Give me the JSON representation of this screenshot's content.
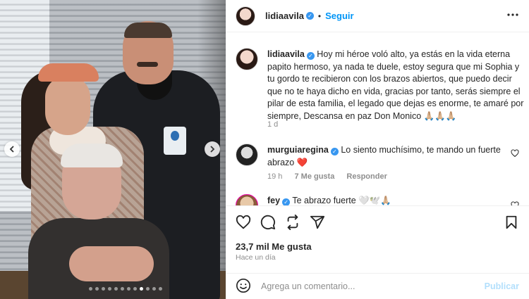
{
  "post": {
    "author": "lidiaavila",
    "follow_label": "Seguir",
    "separator": "•",
    "more_icon": "more-horizontal-icon"
  },
  "caption": {
    "author": "lidiaavila",
    "text": "Hoy mi héroe voló alto, ya estás en la vida eterna papito hermoso, ya nada te duele, estoy segura que mi Sophia y tu gordo te recibieron con los brazos abiertos, que puedo decir que no te haya dicho en vida, gracias por tanto, serás siempre el pilar de esta familia, el legado que dejas es enorme, te amaré por siempre, Descansa en paz Don Monico 🙏🏼🙏🏼🙏🏼",
    "age": "1 d"
  },
  "comments": [
    {
      "author": "murguiaregina",
      "text": "Lo siento muchísimo, te mando un fuerte abrazo ❤️",
      "age": "19 h",
      "likes": "7 Me gusta",
      "reply": "Responder"
    },
    {
      "author": "fey",
      "text": "Te abrazo fuerte 🤍🕊️🙏🏼"
    }
  ],
  "actions": {
    "like_icon": "heart-icon",
    "comment_icon": "comment-icon",
    "share_icon": "repost-icon",
    "send_icon": "send-icon",
    "save_icon": "bookmark-icon"
  },
  "likes_text": "23,7 mil Me gusta",
  "time_text": "Hace un día",
  "composer": {
    "placeholder": "Agrega un comentario...",
    "publish_label": "Publicar"
  },
  "carousel": {
    "total": 12,
    "current": 9,
    "prev_icon": "chevron-left-icon",
    "next_icon": "chevron-right-icon"
  },
  "colors": {
    "accent": "#0095f6",
    "verified": "#3897f0",
    "publish_disabled": "#b2dffc"
  }
}
